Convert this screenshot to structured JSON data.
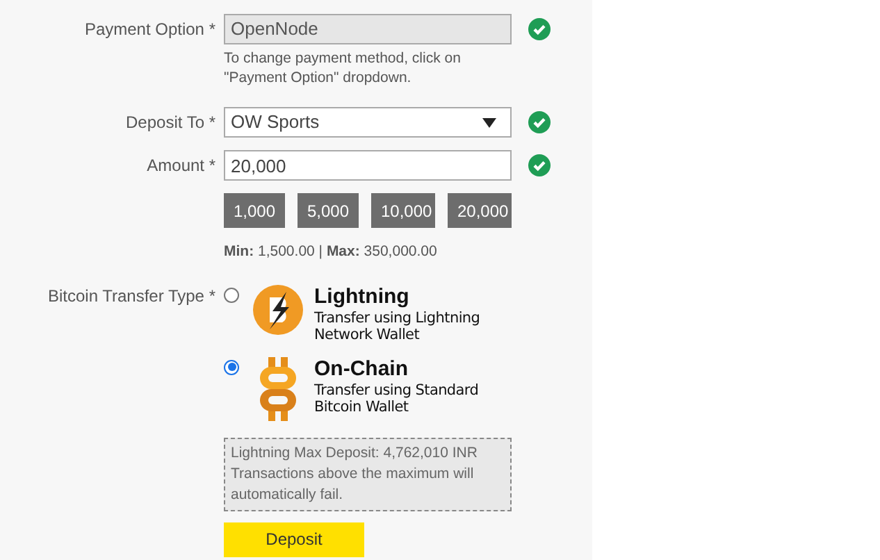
{
  "payment_option": {
    "label": "Payment Option *",
    "value": "OpenNode",
    "valid": true,
    "hint": "To change payment method, click on \"Payment Option\" dropdown."
  },
  "deposit_to": {
    "label": "Deposit To *",
    "value": "OW Sports",
    "valid": true
  },
  "amount": {
    "label": "Amount *",
    "value": "20,000",
    "valid": true,
    "presets": [
      "1,000",
      "5,000",
      "10,000",
      "20,000"
    ],
    "limits": "**Min:** 1,500.00 | **Max:** 350,000.00"
  },
  "transfer_type": {
    "label": "Bitcoin Transfer Type *",
    "options": [
      {
        "kind": "lightning",
        "title": "Lightning",
        "description": "Transfer using Lightning Network Wallet",
        "selected": false
      },
      {
        "kind": "onchain",
        "title": "On-Chain",
        "description": "Transfer using Standard Bitcoin Wallet",
        "selected": true
      }
    ]
  },
  "notice": "Lightning Max Deposit: 4,762,010 INR Transactions above the maximum will automatically fail.",
  "submit": "Deposit"
}
